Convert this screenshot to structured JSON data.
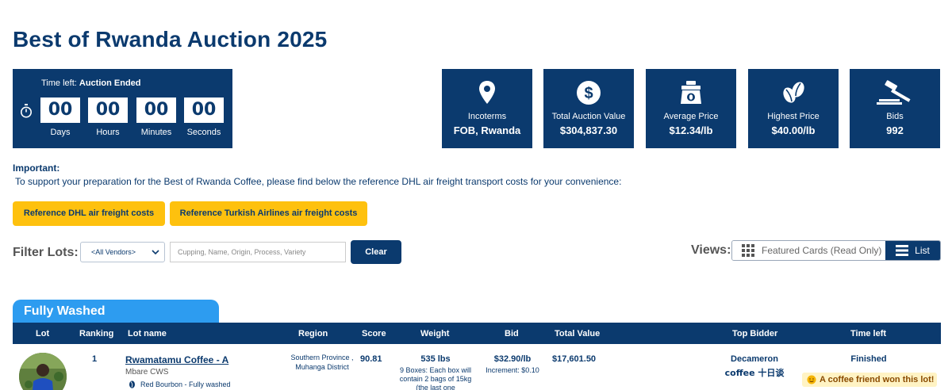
{
  "page": {
    "title": "Best of Rwanda Auction 2025"
  },
  "timer": {
    "label_prefix": "Time left:",
    "status": "Auction Ended",
    "icon": "stopwatch-icon",
    "cells": [
      {
        "value": "00",
        "unit": "Days"
      },
      {
        "value": "00",
        "unit": "Hours"
      },
      {
        "value": "00",
        "unit": "Minutes"
      },
      {
        "value": "00",
        "unit": "Seconds"
      }
    ]
  },
  "stats": [
    {
      "icon": "map-pin-icon",
      "label": "Incoterms",
      "value": "FOB, Rwanda"
    },
    {
      "icon": "dollar-circle-icon",
      "label": "Total Auction Value",
      "value": "$304,837.30"
    },
    {
      "icon": "coffee-bag-icon",
      "label": "Average Price",
      "value": "$12.34/lb"
    },
    {
      "icon": "coffee-bean-icon",
      "label": "Highest Price",
      "value": "$40.00/lb"
    },
    {
      "icon": "gavel-icon",
      "label": "Bids",
      "value": "992"
    }
  ],
  "notice": {
    "heading": "Important:",
    "text": "To support your preparation for the Best of Rwanda Coffee, please find below the reference DHL air freight transport costs for your convenience:"
  },
  "freight_buttons": {
    "dhl": "Reference DHL air freight costs",
    "turkish": "Reference Turkish Airlines air freight costs"
  },
  "filter": {
    "label": "Filter Lots:",
    "vendor_selected": "<All Vendors>",
    "search_placeholder": "Cupping, Name, Origin, Process, Variety",
    "clear_label": "Clear"
  },
  "views": {
    "label": "Views:",
    "featured": "Featured Cards (Read Only)",
    "list": "List"
  },
  "section": {
    "title": "Fully Washed"
  },
  "table": {
    "headers": {
      "lot": "Lot",
      "ranking": "Ranking",
      "lot_name": "Lot name",
      "region": "Region",
      "score": "Score",
      "weight": "Weight",
      "bid": "Bid",
      "total_value": "Total Value",
      "top_bidder": "Top Bidder",
      "time_left": "Time left"
    },
    "rows": [
      {
        "ranking": "1",
        "lot_name": "Rwamatamu Coffee - A",
        "station": "Mbare CWS",
        "variety": "Red Bourbon - Fully washed",
        "region_line1": "Southern Province ,",
        "region_line2": "Muhanga District",
        "score": "90.81",
        "weight": "535 lbs",
        "weight_note": "9 Boxes: Each box will contain 2 bags of 15kg (the last one",
        "bid": "$32.90/lb",
        "increment": "Increment: $0.10",
        "total_value": "$17,601.50",
        "bidder_line1": "Decameron",
        "bidder_line2": "coffee 十日谈",
        "time_left": "Finished",
        "won_badge": "A coffee friend won this lot!"
      }
    ]
  },
  "colors": {
    "navy": "#0b3a6e",
    "yellow": "#fec10e",
    "tab_blue": "#2d9cf0"
  }
}
